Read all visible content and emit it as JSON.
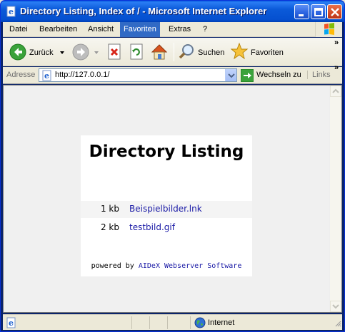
{
  "window": {
    "title": "Directory Listing, Index of / - Microsoft Internet Explorer"
  },
  "menu": {
    "items": [
      "Datei",
      "Bearbeiten",
      "Ansicht",
      "Favoriten",
      "Extras",
      "?"
    ],
    "active": "Favoriten"
  },
  "toolbar": {
    "back_label": "Zurück",
    "search_label": "Suchen",
    "favorites_label": "Favoriten"
  },
  "address": {
    "label": "Adresse",
    "url": "http://127.0.0.1/",
    "go_label": "Wechseln zu",
    "links_label": "Links"
  },
  "page": {
    "title": "Directory Listing",
    "files": [
      {
        "size": "1 kb",
        "name": "Beispielbilder.lnk"
      },
      {
        "size": "2 kb",
        "name": "testbild.gif"
      }
    ],
    "powered_prefix": "powered by ",
    "powered_brand": "AIDeX Webserver Software"
  },
  "status": {
    "zone": "Internet"
  },
  "colors": {
    "titlebar": "#0b5ad9",
    "menu_highlight": "#316ac5",
    "link": "#1a1aa6"
  }
}
